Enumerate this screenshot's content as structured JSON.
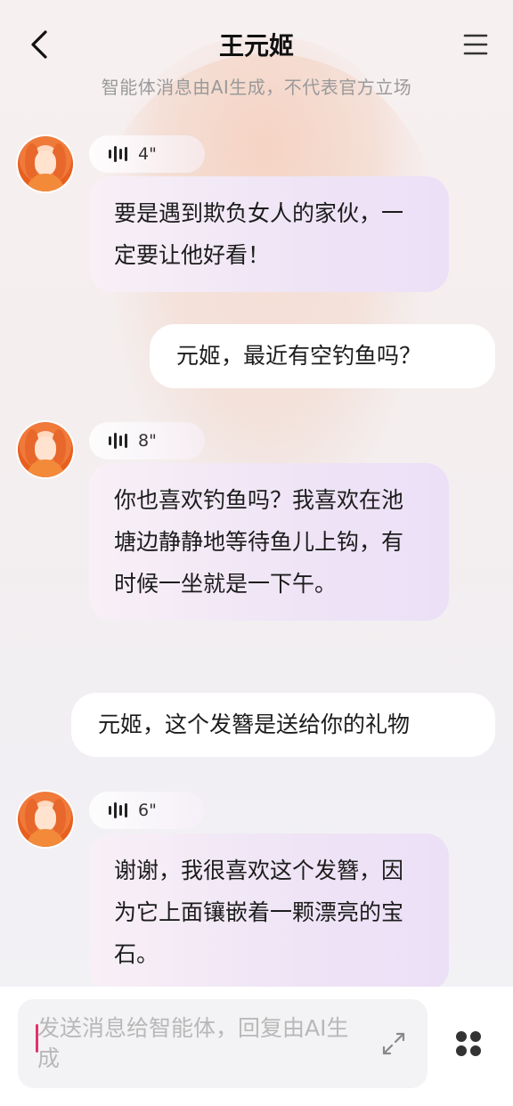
{
  "header": {
    "title": "王元姬",
    "subtitle": "智能体消息由AI生成，不代表官方立场"
  },
  "messages": [
    {
      "role": "ai",
      "voice_duration": "4\"",
      "text": "要是遇到欺负女人的家伙，一定要让他好看！"
    },
    {
      "role": "user",
      "text": "元姬，最近有空钓鱼吗？"
    },
    {
      "role": "ai",
      "voice_duration": "8\"",
      "text": "你也喜欢钓鱼吗？我喜欢在池塘边静静地等待鱼儿上钩，有时候一坐就是一下午。"
    },
    {
      "role": "user",
      "text": "元姬，这个发簪是送给你的礼物"
    },
    {
      "role": "ai",
      "voice_duration": "6\"",
      "text": "谢谢，我很喜欢这个发簪，因为它上面镶嵌着一颗漂亮的宝石。"
    }
  ],
  "input": {
    "placeholder": "发送消息给智能体，回复由AI生成"
  },
  "icons": {
    "back": "chevron-left-icon",
    "menu": "hamburger-menu-icon",
    "voice": "sound-wave-icon",
    "expand": "expand-arrows-icon",
    "more": "four-dots-grid-icon"
  },
  "colors": {
    "ai_bubble": "#eee4f6",
    "user_bubble": "#ffffff",
    "cursor": "#e0336b",
    "avatar_accent": "#e8672a"
  }
}
